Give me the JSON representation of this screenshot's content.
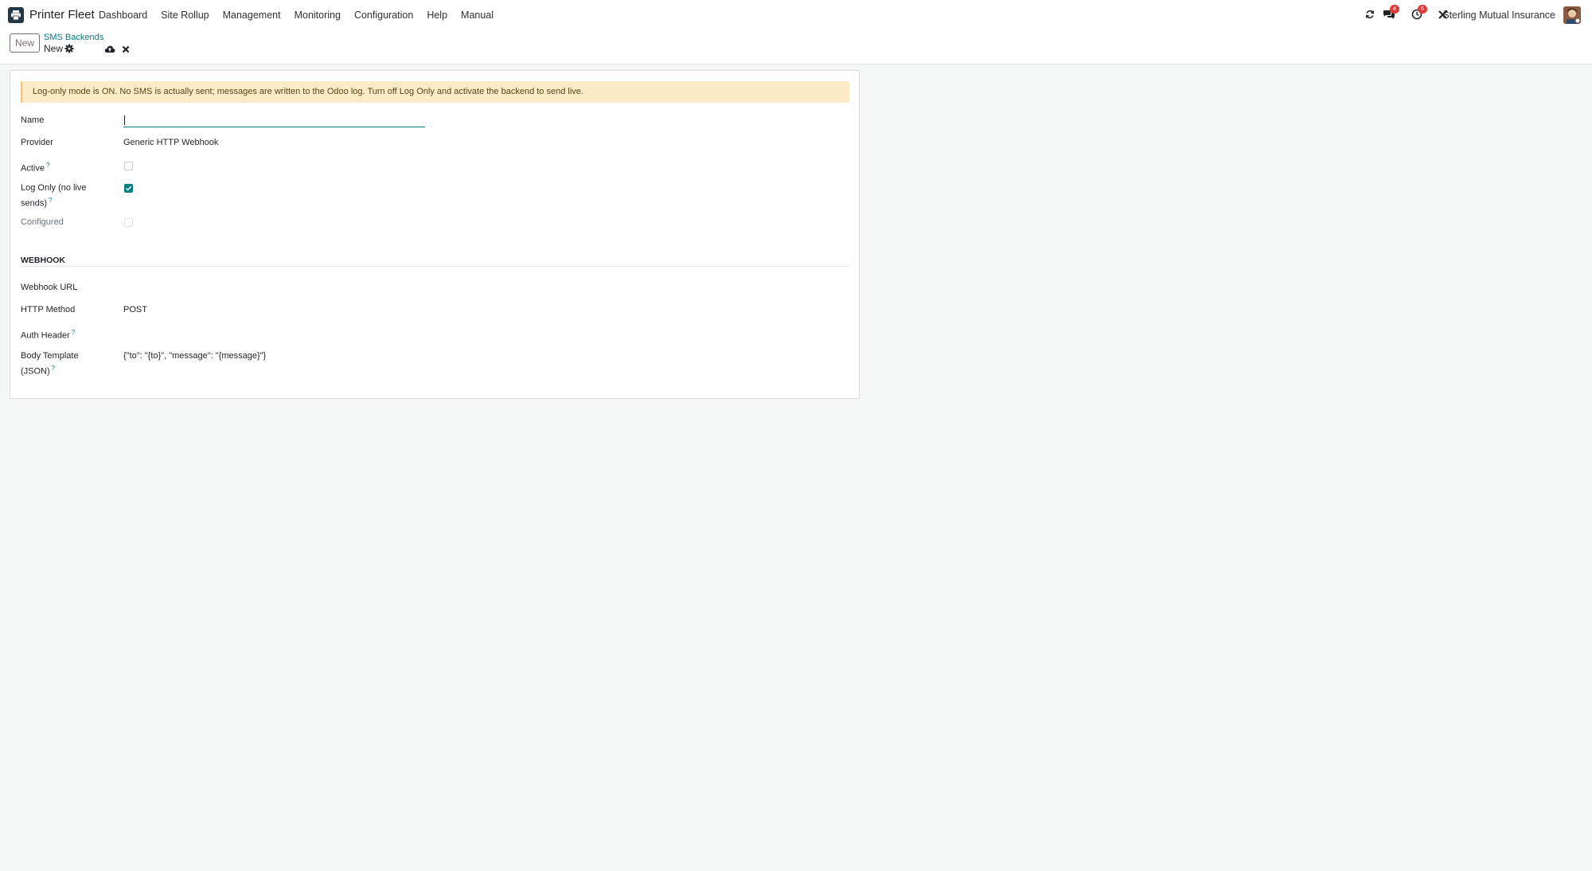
{
  "navbar": {
    "app_name": "Printer Fleet",
    "menu": [
      "Dashboard",
      "Site Rollup",
      "Management",
      "Monitoring",
      "Configuration",
      "Help",
      "Manual"
    ],
    "messages_count": "4",
    "activities_count": "6",
    "company": "Sterling Mutual Insurance",
    "icons": [
      "printer-icon",
      "refresh-icon",
      "chat-icon",
      "clock-icon",
      "tools-icon",
      "avatar"
    ]
  },
  "control": {
    "new_label": "New",
    "breadcrumb_parent": "SMS Backends",
    "breadcrumb_current": "New"
  },
  "form": {
    "alert": "Log-only mode is ON. No SMS is actually sent; messages are written to the Odoo log. Turn off Log Only and activate the backend to send live.",
    "name_label": "Name",
    "name_value": "",
    "provider_label": "Provider",
    "provider_value": "Generic HTTP Webhook",
    "active_label": "Active",
    "active_checked": false,
    "log_only_label_1": "Log Only (no live",
    "log_only_label_2": "sends)",
    "log_only_checked": true,
    "configured_label": "Configured",
    "configured_checked": false,
    "help_mark": "?",
    "webhook_section": "WEBHOOK",
    "webhook_url_label": "Webhook URL",
    "webhook_url_value": "",
    "http_method_label": "HTTP Method",
    "http_method_value": "POST",
    "auth_header_label": "Auth Header",
    "auth_header_value": "",
    "body_template_label_1": "Body Template",
    "body_template_label_2": "(JSON)",
    "body_template_value": "{\"to\": \"{to}\", \"message\": \"{message}\"}"
  },
  "colors": {
    "accent": "#017e84",
    "brand": "#7c6a78",
    "alert_bg": "#fbebc7",
    "badge": "#e03a3a"
  }
}
